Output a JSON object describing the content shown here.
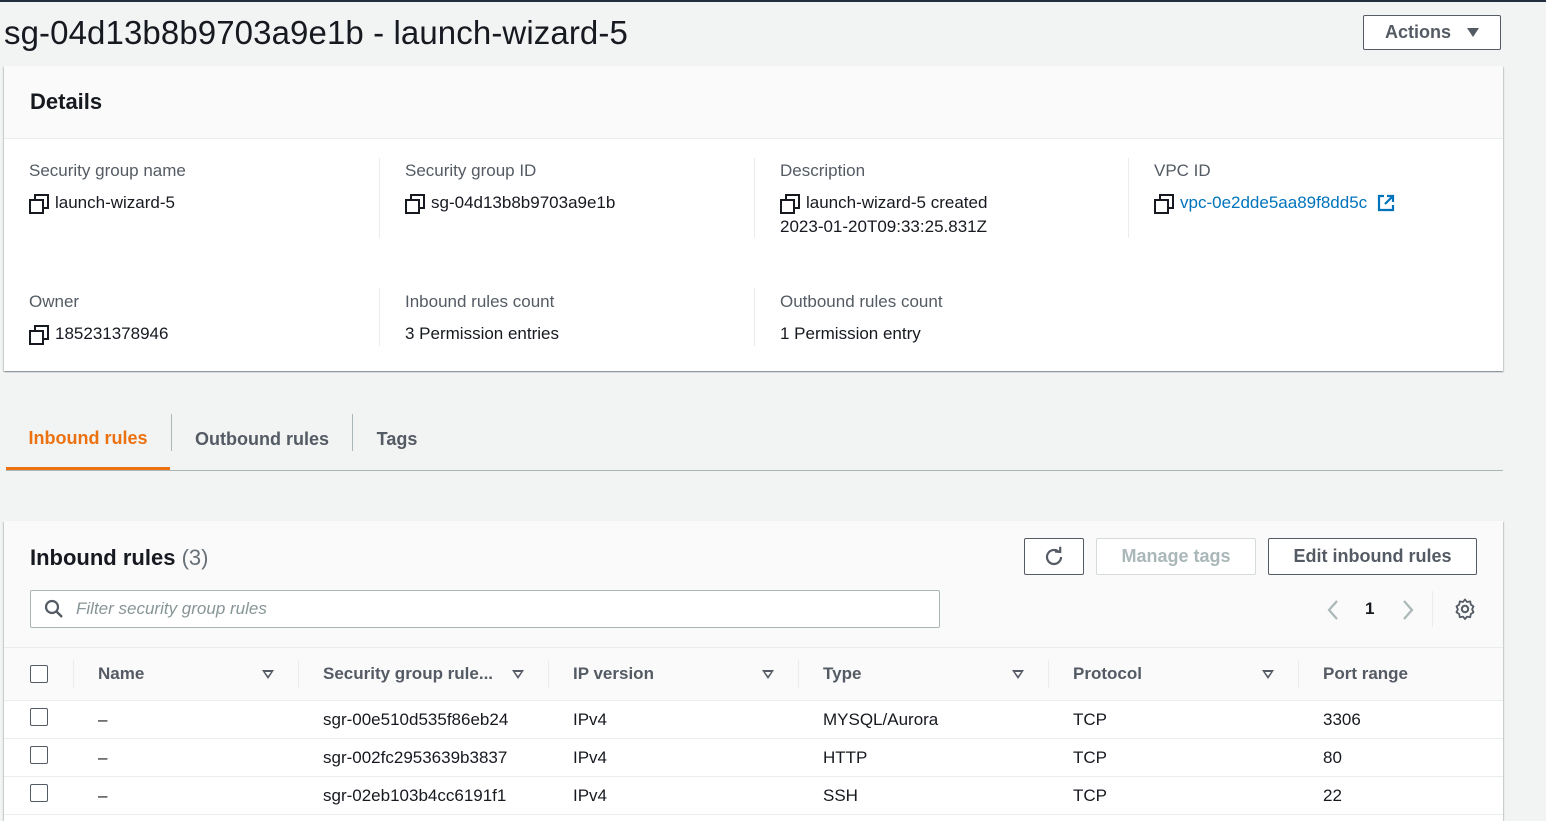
{
  "page": {
    "title": "sg-04d13b8b9703a9e1b - launch-wizard-5",
    "actions_label": "Actions"
  },
  "details": {
    "heading": "Details",
    "sg_name_label": "Security group name",
    "sg_name_value": "launch-wizard-5",
    "sg_id_label": "Security group ID",
    "sg_id_value": "sg-04d13b8b9703a9e1b",
    "description_label": "Description",
    "description_line1": "launch-wizard-5 created",
    "description_line2": "2023-01-20T09:33:25.831Z",
    "vpc_label": "VPC ID",
    "vpc_value": "vpc-0e2dde5aa89f8dd5c",
    "owner_label": "Owner",
    "owner_value": "185231378946",
    "inbound_count_label": "Inbound rules count",
    "inbound_count_value": "3 Permission entries",
    "outbound_count_label": "Outbound rules count",
    "outbound_count_value": "1 Permission entry"
  },
  "tabs": [
    {
      "label": "Inbound rules",
      "active": true
    },
    {
      "label": "Outbound rules",
      "active": false
    },
    {
      "label": "Tags",
      "active": false
    }
  ],
  "inbound": {
    "title": "Inbound rules",
    "count": "(3)",
    "manage_tags_label": "Manage tags",
    "edit_label": "Edit inbound rules",
    "search_placeholder": "Filter security group rules",
    "current_page": "1",
    "columns": [
      "Name",
      "Security group rule...",
      "IP version",
      "Type",
      "Protocol",
      "Port range"
    ],
    "rows": [
      {
        "name": "–",
        "rule_id": "sgr-00e510d535f86eb24",
        "ip_version": "IPv4",
        "type": "MYSQL/Aurora",
        "protocol": "TCP",
        "port_range": "3306"
      },
      {
        "name": "–",
        "rule_id": "sgr-002fc2953639b3837",
        "ip_version": "IPv4",
        "type": "HTTP",
        "protocol": "TCP",
        "port_range": "80"
      },
      {
        "name": "–",
        "rule_id": "sgr-02eb103b4cc6191f1",
        "ip_version": "IPv4",
        "type": "SSH",
        "protocol": "TCP",
        "port_range": "22"
      }
    ]
  },
  "colors": {
    "accent_orange": "#ec7211",
    "link_blue": "#0073bb",
    "text_dark": "#16191f",
    "text_gray": "#545b64"
  },
  "icons": {
    "actions_caret": "caret-down-icon",
    "copy": "copy-icon",
    "external": "external-link-icon",
    "refresh": "refresh-icon",
    "search": "search-icon",
    "prev": "chevron-left-icon",
    "next": "chevron-right-icon",
    "settings": "gear-icon",
    "sort": "sort-icon"
  }
}
